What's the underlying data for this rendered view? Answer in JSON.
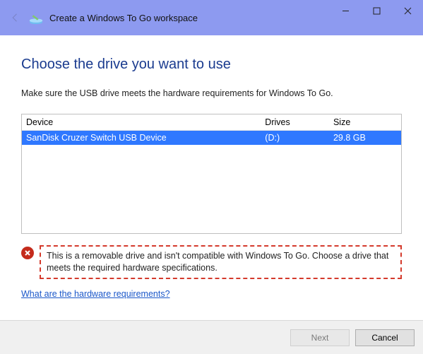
{
  "window": {
    "title": "Create a Windows To Go workspace"
  },
  "page": {
    "heading": "Choose the drive you want to use",
    "instruction": "Make sure the USB drive meets the hardware requirements for Windows To Go."
  },
  "table": {
    "columns": {
      "device": "Device",
      "drives": "Drives",
      "size": "Size"
    },
    "rows": [
      {
        "device": "SanDisk Cruzer Switch USB Device",
        "drives": "(D:)",
        "size": "29.8 GB",
        "selected": true
      }
    ]
  },
  "warning": {
    "text": "This is a removable drive and isn't compatible with Windows To Go. Choose a drive that meets the required hardware specifications."
  },
  "link": {
    "label": "What are the hardware requirements?"
  },
  "buttons": {
    "next": "Next",
    "cancel": "Cancel"
  }
}
